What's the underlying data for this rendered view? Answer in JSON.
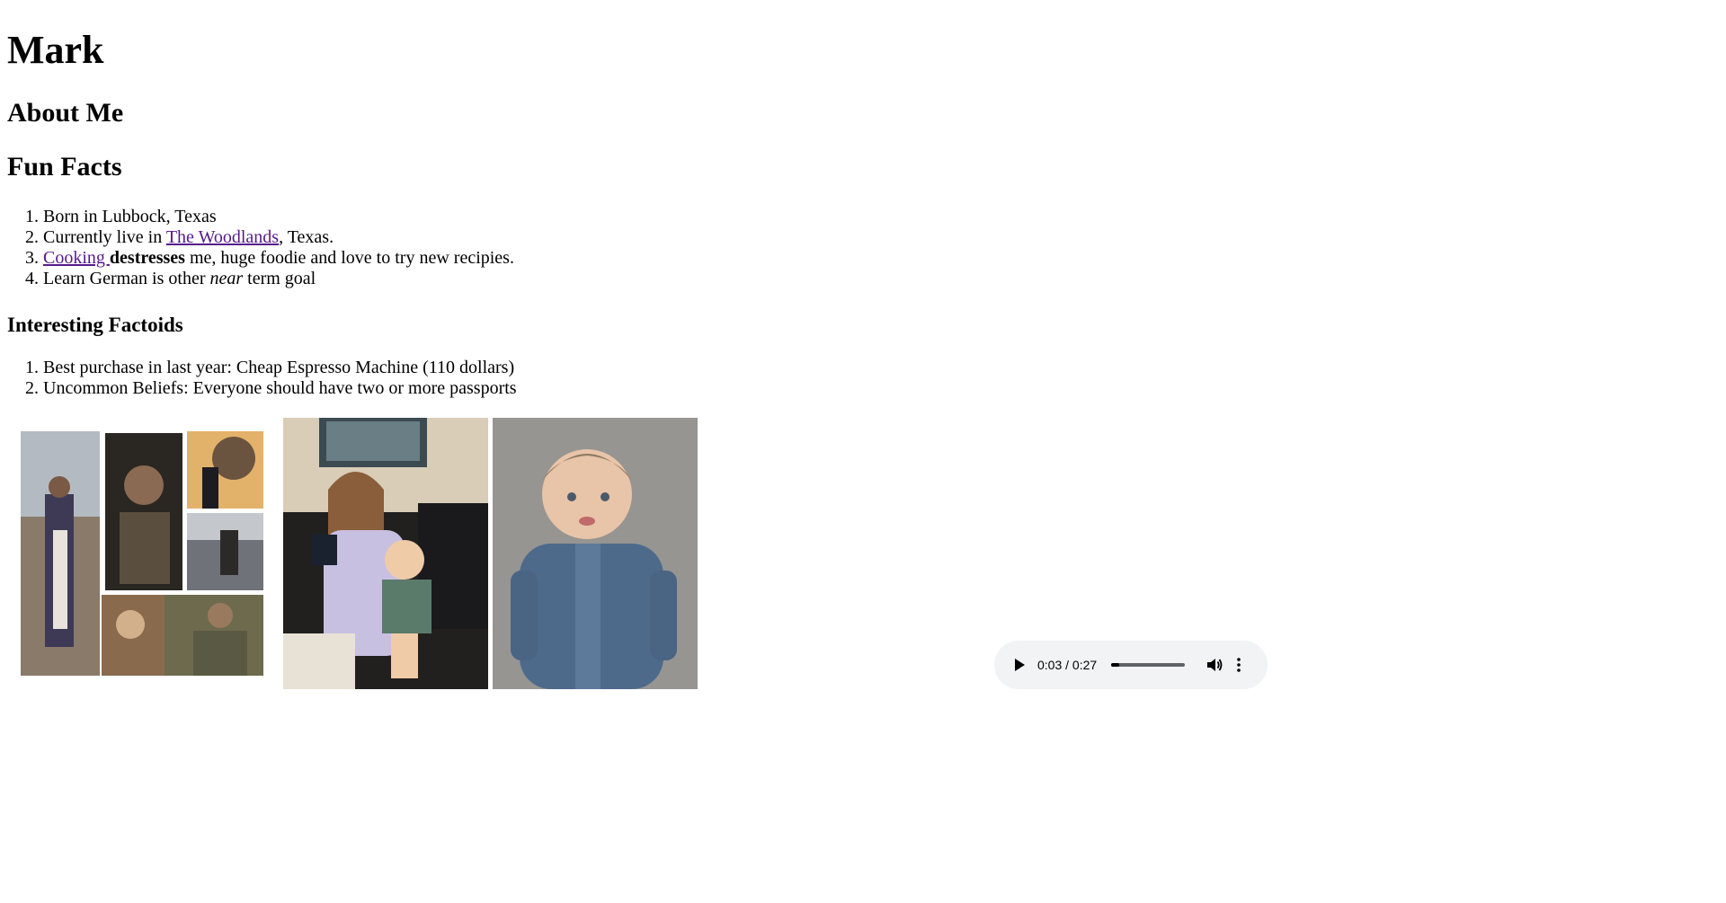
{
  "page": {
    "name": "Mark",
    "about_heading": "About Me",
    "fun_facts_heading": "Fun Facts",
    "factoids_heading": "Interesting Factoids"
  },
  "fun_facts": [
    {
      "text": "Born in Lubbock, Texas"
    },
    {
      "prefix": "Currently live in ",
      "link": "The Woodlands",
      "suffix": ", Texas."
    },
    {
      "link": "Cooking ",
      "bold": "destresses",
      "suffix": " me, huge foodie and love to try new recipies."
    },
    {
      "prefix": "Learn German is other ",
      "italic": "near",
      "suffix": " term goal"
    }
  ],
  "factoids": [
    "Best purchase in last year: Cheap Espresso Machine (110 dollars)",
    "Uncommon Beliefs: Everyone should have two or more passports"
  ],
  "audio": {
    "time": "0:03 / 0:27",
    "progress": 0.11
  },
  "colors": {
    "link": "#551a8b",
    "audio_bg": "#f1f3f4"
  }
}
